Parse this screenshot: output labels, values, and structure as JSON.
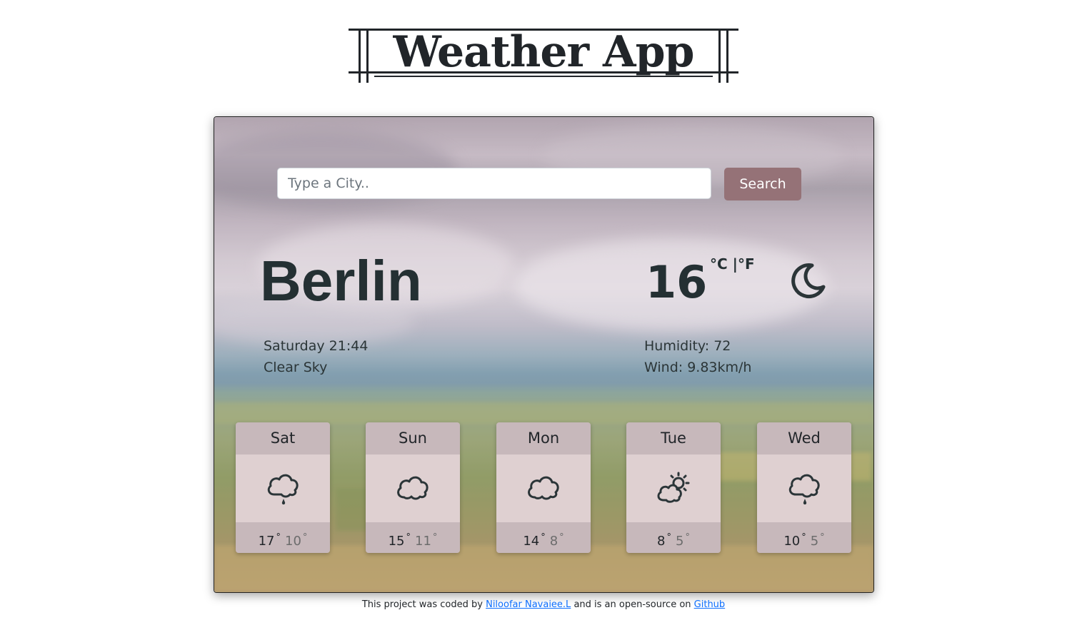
{
  "header": {
    "title": "Weather App"
  },
  "search": {
    "placeholder": "Type a City..",
    "button_label": "Search"
  },
  "current": {
    "city": "Berlin",
    "temperature": "16",
    "unit_c": "°C",
    "unit_separator": " |",
    "unit_f": "°F",
    "icon": "moon-icon",
    "datetime": "Saturday 21:44",
    "description": "Clear Sky",
    "humidity": "Humidity: 72",
    "wind": "Wind: 9.83km/h"
  },
  "forecast": [
    {
      "day": "Sat",
      "icon": "cloud-rain-icon",
      "high": "17",
      "low": "10"
    },
    {
      "day": "Sun",
      "icon": "cloud-icon",
      "high": "15",
      "low": "11"
    },
    {
      "day": "Mon",
      "icon": "cloud-icon",
      "high": "14",
      "low": "8"
    },
    {
      "day": "Tue",
      "icon": "partly-sunny-icon",
      "high": "8",
      "low": "5"
    },
    {
      "day": "Wed",
      "icon": "cloud-rain-icon",
      "high": "10",
      "low": "5"
    }
  ],
  "degree_symbol": "°",
  "footer": {
    "text_before": "This project was coded by ",
    "author_link": "Niloofar Navaiee.L",
    "text_middle": " and is an open-source on ",
    "repo_link": "Github"
  },
  "colors": {
    "accent": "#957277",
    "text_dark": "#243033",
    "card_header": "#c7b8bb",
    "card_body": "#dfd0d1",
    "link": "#0d6efd"
  }
}
